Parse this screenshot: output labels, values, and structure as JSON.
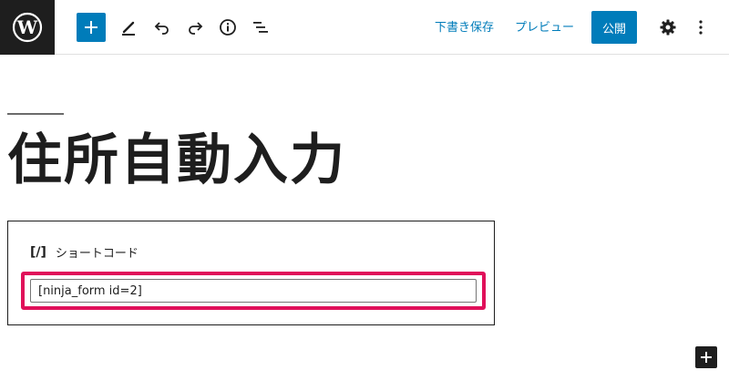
{
  "toolbar": {
    "save_draft_label": "下書き保存",
    "preview_label": "プレビュー",
    "publish_label": "公開"
  },
  "post": {
    "title": "住所自動入力"
  },
  "shortcode_block": {
    "icon": "[/]",
    "label": "ショートコード",
    "value": "[ninja_form id=2]"
  },
  "colors": {
    "accent": "#007cba",
    "highlight": "#e0105a",
    "dark": "#1e1e1e"
  }
}
